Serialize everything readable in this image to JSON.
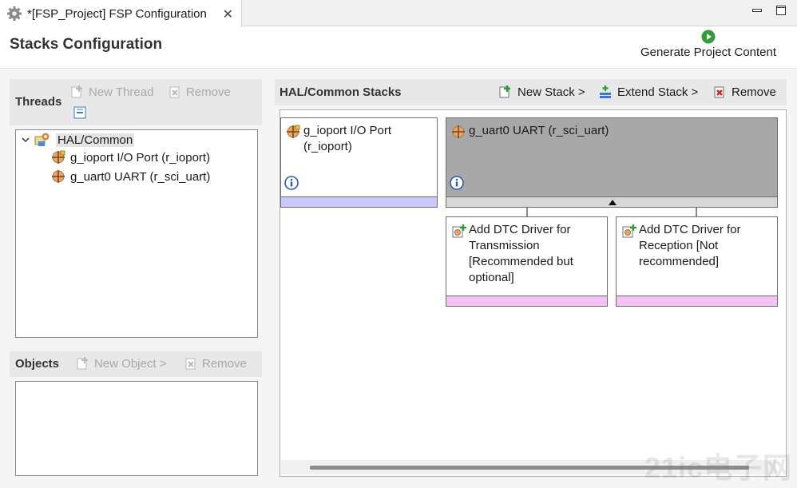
{
  "tab": {
    "title": "*[FSP_Project] FSP Configuration",
    "close": "✕"
  },
  "header": {
    "title": "Stacks Configuration",
    "generate_label": "Generate Project Content"
  },
  "threads": {
    "title": "Threads",
    "new_thread": "New Thread",
    "remove": "Remove",
    "tree": {
      "root": "HAL/Common",
      "children": [
        "g_ioport I/O Port (r_ioport)",
        "g_uart0 UART (r_sci_uart)"
      ]
    }
  },
  "objects": {
    "title": "Objects",
    "new_object": "New Object >",
    "remove": "Remove"
  },
  "stacks": {
    "title": "HAL/Common Stacks",
    "new_stack": "New Stack >",
    "extend_stack": "Extend Stack >",
    "remove": "Remove",
    "cards": [
      {
        "line1": "g_ioport I/O Port",
        "line2": "(r_ioport)"
      },
      {
        "line1": "g_uart0 UART (r_sci_uart)"
      }
    ],
    "sub_cards": [
      {
        "lines": [
          "Add DTC Driver for",
          "Transmission",
          "[Recommended but",
          "optional]"
        ]
      },
      {
        "lines": [
          "Add DTC Driver for",
          "Reception [Not",
          "recommended]"
        ]
      }
    ]
  },
  "watermark": "21ic电子网",
  "colors": {
    "module_strip": "#c8c8ff",
    "optional_strip": "#f4c2f4",
    "selected_card": "#a8a8a8",
    "play_green": "#2f9e3a"
  }
}
